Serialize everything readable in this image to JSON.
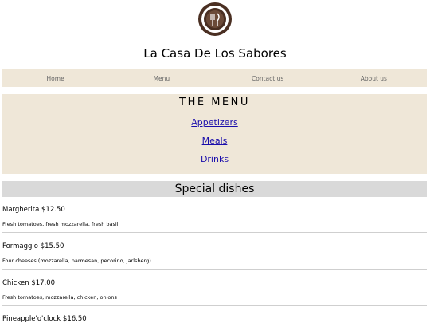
{
  "header": {
    "site_title": "La Casa De Los Sabores",
    "logo_icon": "restaurant-logo-icon"
  },
  "nav": {
    "items": [
      {
        "label": "Home"
      },
      {
        "label": "Menu"
      },
      {
        "label": "Contact us"
      },
      {
        "label": "About us"
      }
    ]
  },
  "menu": {
    "heading": "THE MENU",
    "links": [
      {
        "label": "Appetizers"
      },
      {
        "label": "Meals"
      },
      {
        "label": "Drinks"
      }
    ]
  },
  "special": {
    "title": "Special dishes",
    "dishes": [
      {
        "name": "Margherita $12.50",
        "desc": "Fresh tomatoes, fresh mozzarella, fresh basil"
      },
      {
        "name": "Formaggio $15.50",
        "desc": "Four cheeses (mozzarella, parmesan, pecorino, jarlsberg)"
      },
      {
        "name": "Chicken $17.00",
        "desc": "Fresh tomatoes, mozzarella, chicken, onions"
      },
      {
        "name": "Pineapple'o'clock $16.50",
        "desc": ""
      }
    ]
  },
  "colors": {
    "nav_bg": "#efe7d8",
    "menu_bg": "#efe7d8",
    "special_bg": "#d9d9d9",
    "link": "#1a0dab",
    "logo": "#4a2f22"
  }
}
